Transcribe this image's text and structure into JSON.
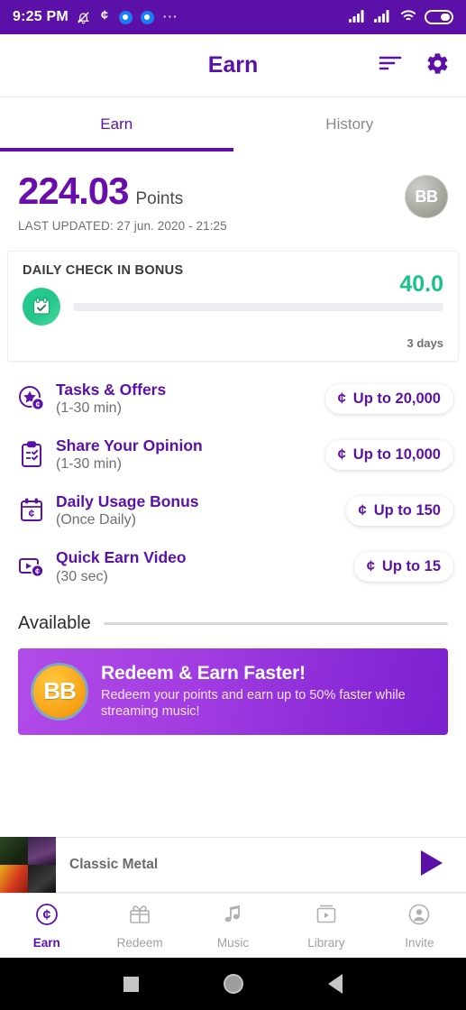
{
  "colors": {
    "brand_purple": "#5B11A8",
    "points_purple": "#6A0DAD",
    "green": "#18C38A",
    "orange": "#F8A61B"
  },
  "statusbar": {
    "time": "9:25 PM",
    "icons": [
      "bell-muted-icon",
      "cent-icon",
      "blue-circle-icon",
      "blue-circle-icon",
      "ellipsis-icon"
    ],
    "right_icons": [
      "signal-bars-icon",
      "signal-bars-icon",
      "wifi-icon",
      "battery-icon"
    ]
  },
  "appbar": {
    "title": "Earn",
    "actions": [
      "sort-icon",
      "settings-gear-icon"
    ]
  },
  "tabs": [
    {
      "label": "Earn",
      "active": true
    },
    {
      "label": "History",
      "active": false
    }
  ],
  "points": {
    "value": "224.03",
    "unit": "Points",
    "last_updated": "LAST UPDATED: 27 jun. 2020 - 21:25",
    "avatar_initials": "BB"
  },
  "checkin": {
    "title": "DAILY CHECK IN BONUS",
    "amount": "40.0",
    "days": "3 days",
    "progress_percent": 0,
    "icon": "calendar-check-icon"
  },
  "earn_items": [
    {
      "title": "Tasks & Offers",
      "subtitle": "(1-30 min)",
      "reward": "Up to 20,000",
      "icon": "star-coin-icon"
    },
    {
      "title": "Share Your Opinion",
      "subtitle": "(1-30 min)",
      "reward": "Up to 10,000",
      "icon": "clipboard-survey-icon"
    },
    {
      "title": "Daily Usage Bonus",
      "subtitle": "(Once Daily)",
      "reward": "Up to 150",
      "icon": "calendar-coin-icon"
    },
    {
      "title": "Quick Earn Video",
      "subtitle": "(30 sec)",
      "reward": "Up to 15",
      "icon": "video-coin-icon"
    }
  ],
  "available": {
    "label": "Available"
  },
  "promo": {
    "logo_initials": "BB",
    "title": "Redeem & Earn Faster!",
    "subtitle": "Redeem your points and earn up to 50% faster while streaming music!"
  },
  "miniplayer": {
    "track_title": "Classic Metal",
    "play_icon": "play-icon"
  },
  "bottom_nav": [
    {
      "label": "Earn",
      "icon": "coin-circle-icon",
      "active": true
    },
    {
      "label": "Redeem",
      "icon": "gift-icon",
      "active": false
    },
    {
      "label": "Music",
      "icon": "music-note-icon",
      "active": false
    },
    {
      "label": "Library",
      "icon": "library-play-icon",
      "active": false
    },
    {
      "label": "Invite",
      "icon": "person-circle-icon",
      "active": false
    }
  ],
  "android_nav": [
    "recents-square-icon",
    "home-circle-icon",
    "back-triangle-icon"
  ]
}
